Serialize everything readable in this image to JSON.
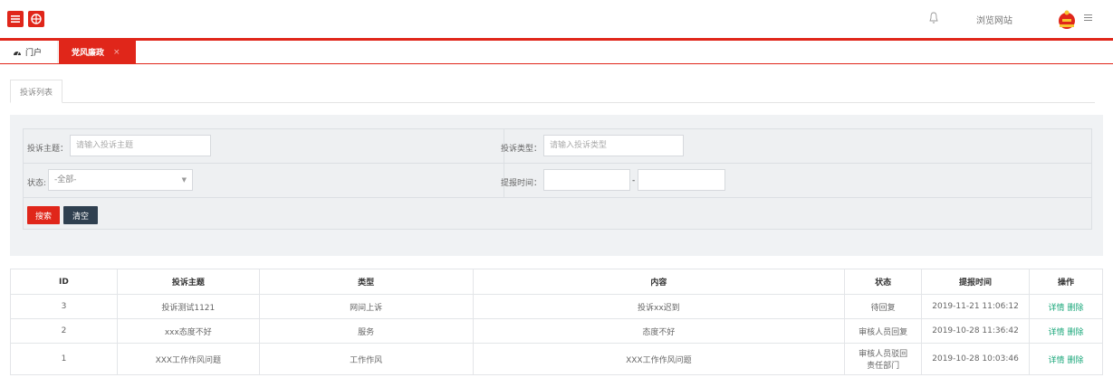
{
  "colors": {
    "brand_red": "#e0261a",
    "dark_button": "#2f4050",
    "link_green": "#1aa77a"
  },
  "header": {
    "menu_icon": "hamburger-icon",
    "globe_icon": "globe-icon",
    "bell_icon": "bell-icon",
    "browse_label": "浏览网站",
    "avatar_icon": "avatar-icon"
  },
  "tabs": {
    "home_label": "门户",
    "active_label": "党风廉政",
    "close_glyph": "×"
  },
  "subtab": {
    "label": "投诉列表"
  },
  "search": {
    "subject_label": "投诉主题：",
    "subject_placeholder": "请输入投诉主题",
    "type_label": "投诉类型：",
    "type_placeholder": "请输入投诉类型",
    "status_label": "状态:",
    "status_value": "-全部-",
    "time_label": "提报时间：",
    "range_sep": "-",
    "search_button": "搜索",
    "clear_button": "清空"
  },
  "table": {
    "headers": [
      "ID",
      "投诉主题",
      "类型",
      "内容",
      "状态",
      "提报时间",
      "操作"
    ],
    "rows": [
      {
        "id": "3",
        "subject": "投诉测试1121",
        "type": "网间上诉",
        "content": "投诉xx迟到",
        "status": "待回复",
        "time": "2019-11-21 11:06:12",
        "detail": "详情",
        "delete": "删除"
      },
      {
        "id": "2",
        "subject": "xxx态度不好",
        "type": "服务",
        "content": "态度不好",
        "status": "审核人员回复",
        "time": "2019-10-28 11:36:42",
        "detail": "详情",
        "delete": "删除"
      },
      {
        "id": "1",
        "subject": "XXX工作作风问题",
        "type": "工作作风",
        "content": "XXX工作作风问题",
        "status": "审核人员驳回责任部门",
        "time": "2019-10-28 10:03:46",
        "detail": "详情",
        "delete": "删除"
      }
    ]
  }
}
